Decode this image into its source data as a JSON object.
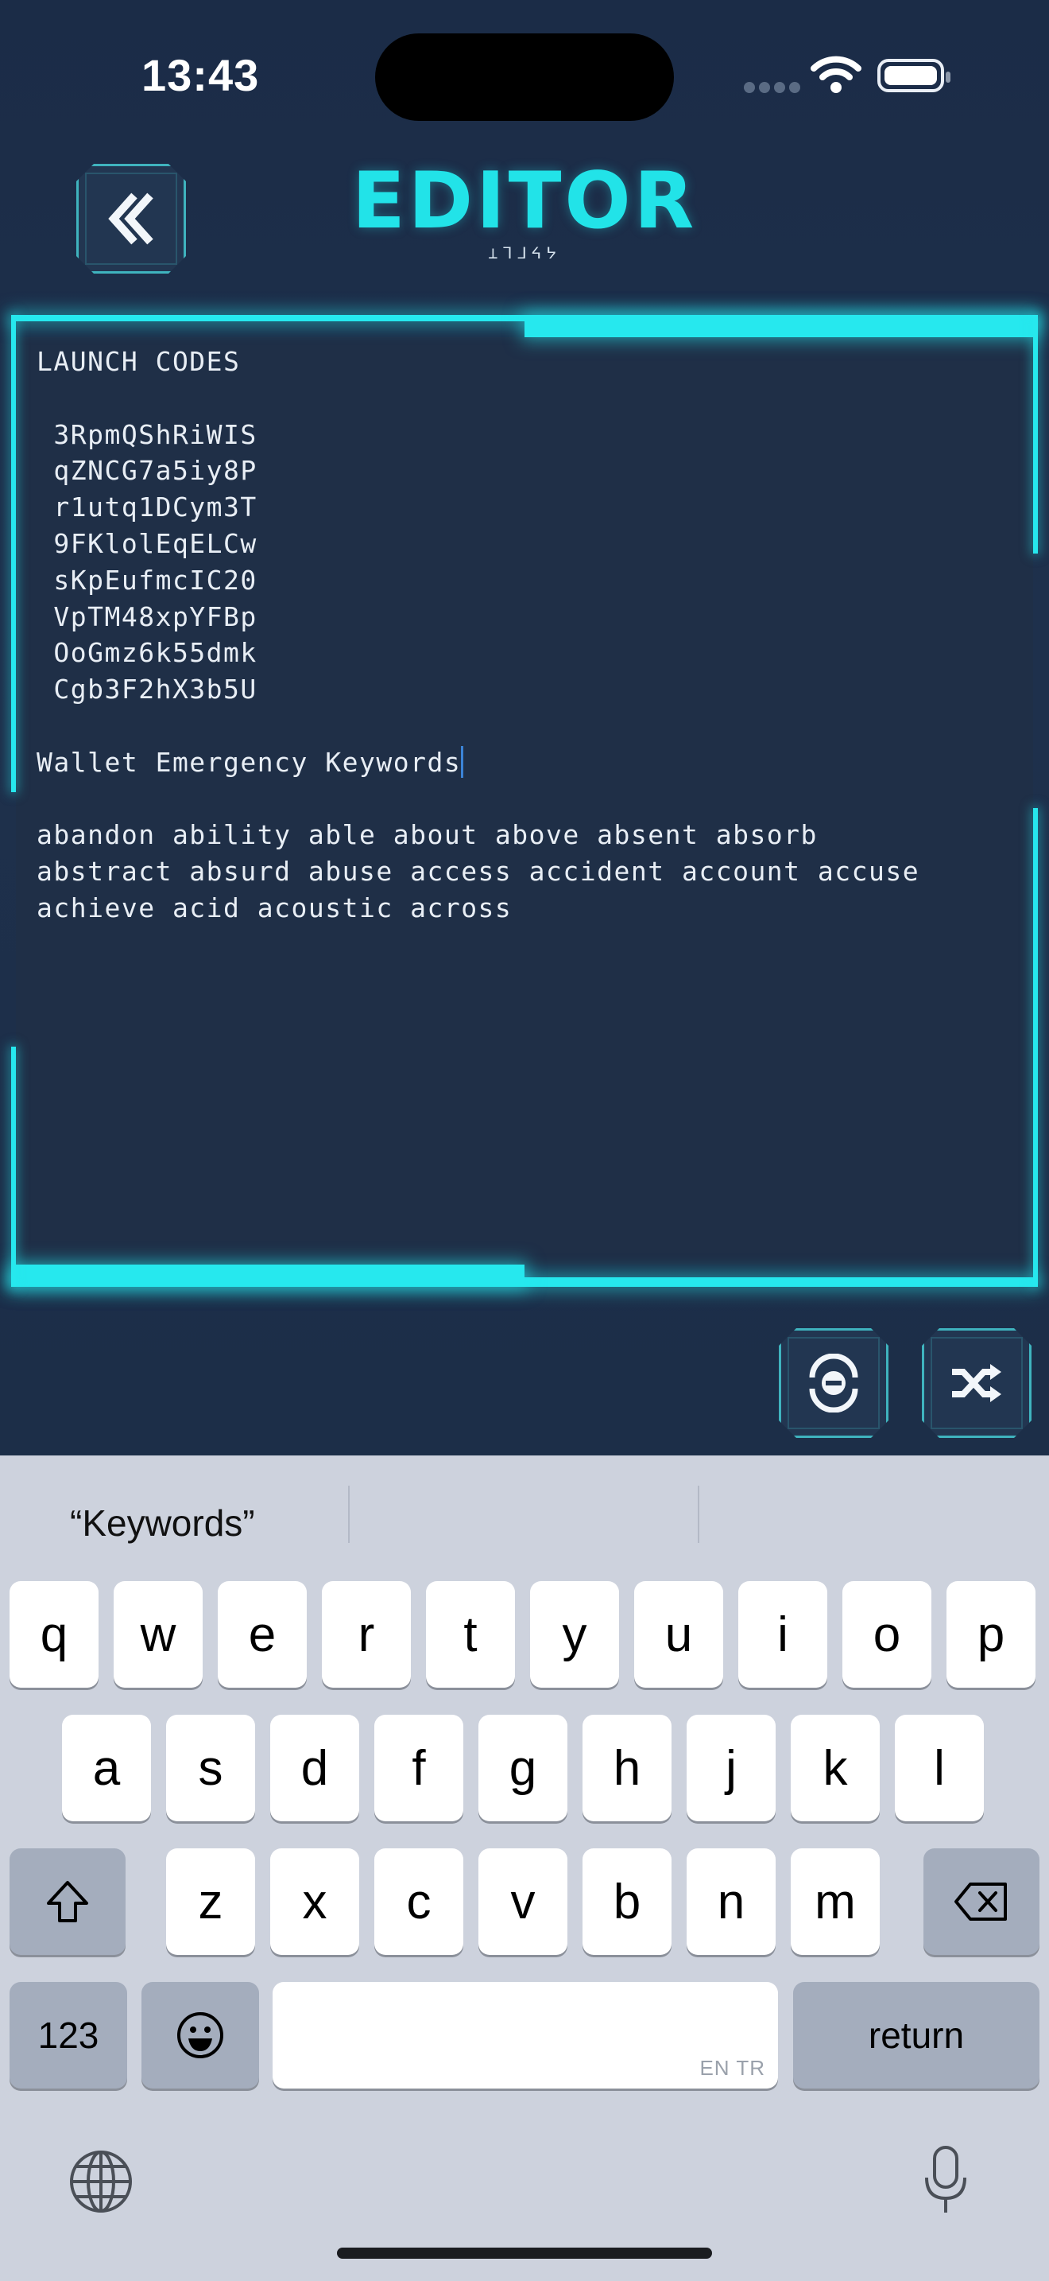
{
  "status_bar": {
    "time": "13:43"
  },
  "header": {
    "title": "EDITOR",
    "subtitle": "⟂ᒣᒧᔦᔭ"
  },
  "editor": {
    "content": "LAUNCH CODES\n\n 3RpmQShRiWIS\n qZNCG7a5iy8P\n r1utq1DCym3T\n 9FKlolEqELCw\n sKpEufmcIC20\n VpTM48xpYFBp\n OoGmz6k55dmk\n Cgb3F2hX3b5U\n\nWallet Emergency Keywords",
    "content_after": "\n\nabandon ability able about above absent absorb\nabstract absurd abuse access accident account accuse\nachieve acid acoustic across"
  },
  "keyboard": {
    "suggestions": [
      "“Keywords”",
      "",
      ""
    ],
    "row1": [
      "q",
      "w",
      "e",
      "r",
      "t",
      "y",
      "u",
      "i",
      "o",
      "p"
    ],
    "row2": [
      "a",
      "s",
      "d",
      "f",
      "g",
      "h",
      "j",
      "k",
      "l"
    ],
    "row3": [
      "z",
      "x",
      "c",
      "v",
      "b",
      "n",
      "m"
    ],
    "numbers_label": "123",
    "return_label": "return",
    "space_lang": "EN TR"
  },
  "colors": {
    "accent": "#26e8ee",
    "background": "#1c2d47",
    "caret": "#3b83d6"
  }
}
